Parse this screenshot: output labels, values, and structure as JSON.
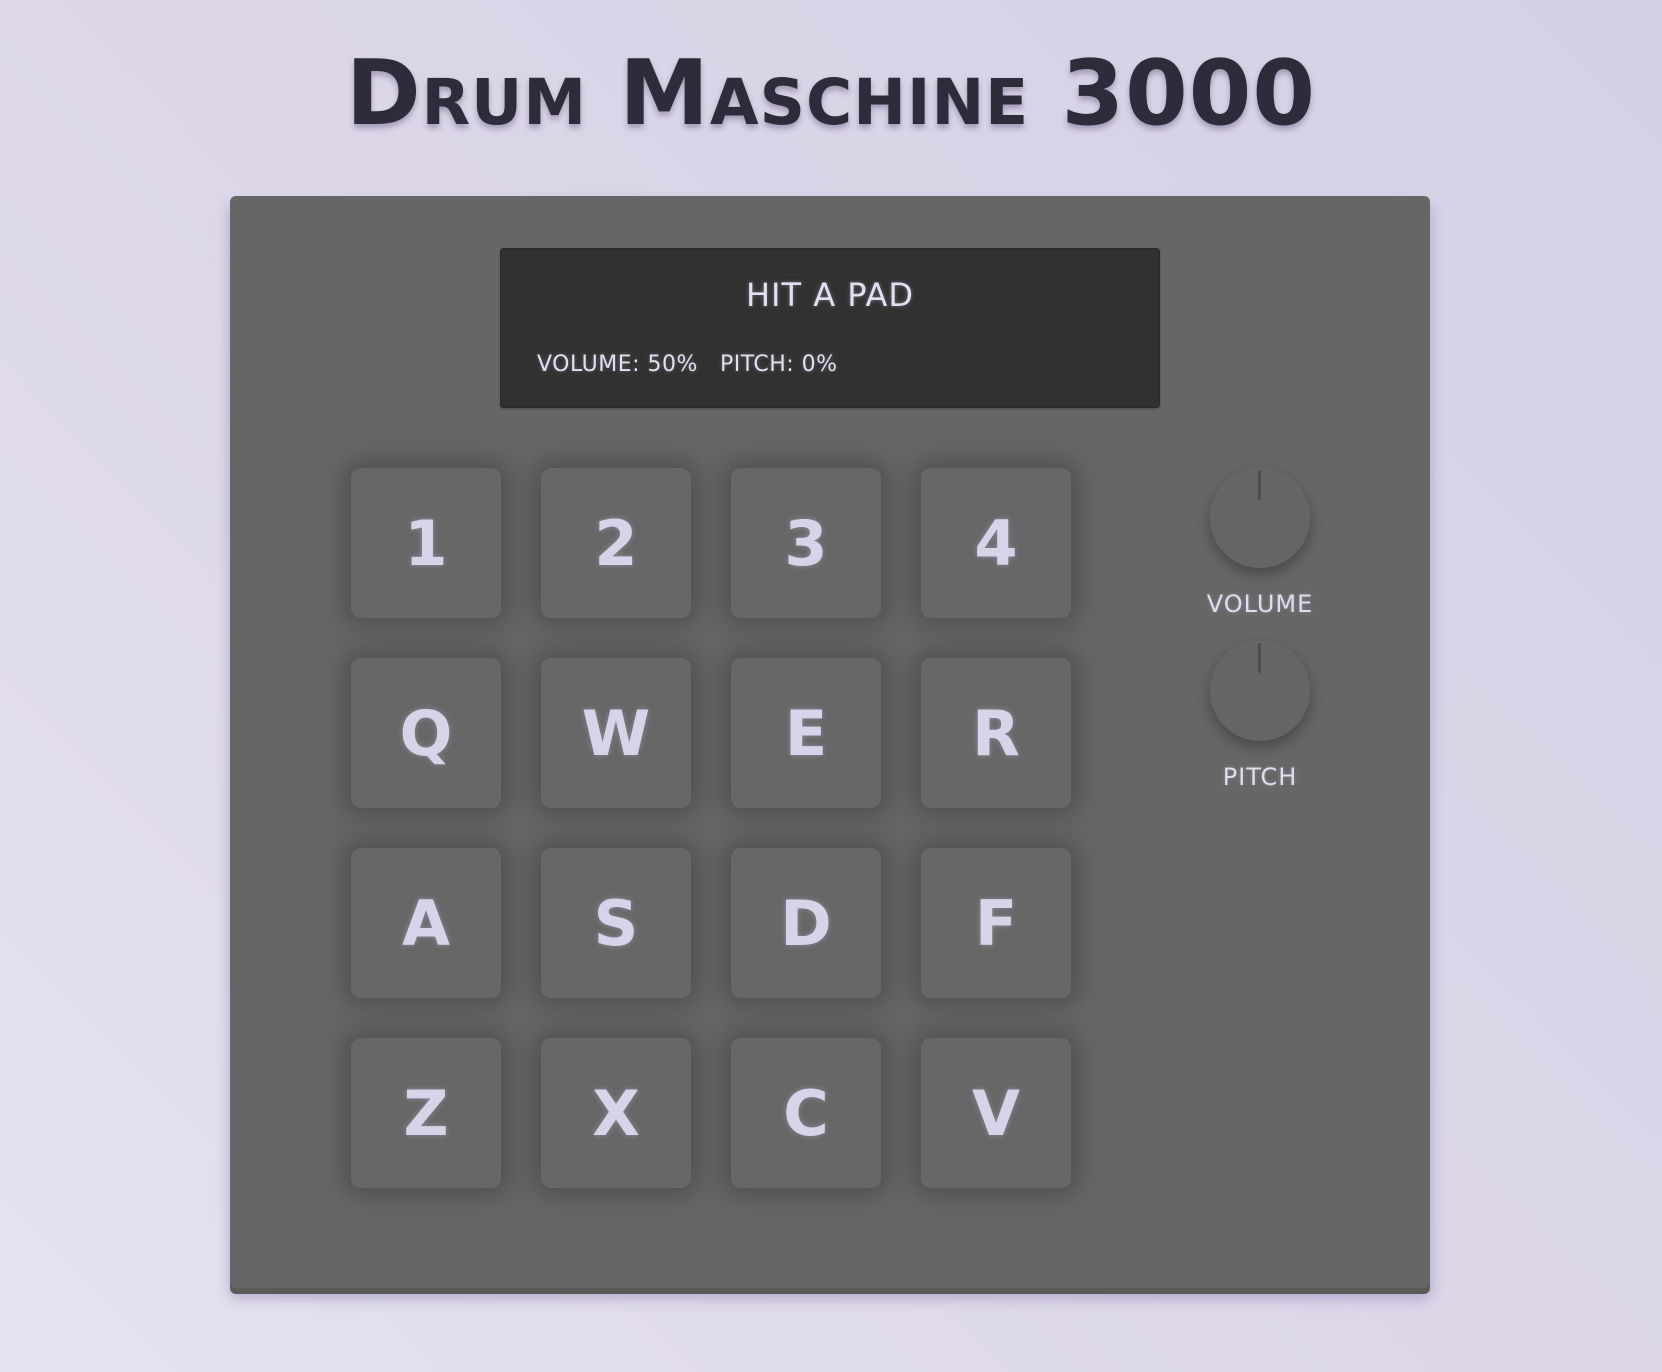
{
  "app": {
    "title": "Drum Maschine 3000"
  },
  "display": {
    "message": "HIT A PAD",
    "volume_text": "VOLUME: 50%",
    "pitch_text": "PITCH: 0%"
  },
  "pads": [
    {
      "key": "1"
    },
    {
      "key": "2"
    },
    {
      "key": "3"
    },
    {
      "key": "4"
    },
    {
      "key": "Q"
    },
    {
      "key": "W"
    },
    {
      "key": "E"
    },
    {
      "key": "R"
    },
    {
      "key": "A"
    },
    {
      "key": "S"
    },
    {
      "key": "D"
    },
    {
      "key": "F"
    },
    {
      "key": "Z"
    },
    {
      "key": "X"
    },
    {
      "key": "C"
    },
    {
      "key": "V"
    }
  ],
  "knobs": {
    "volume": {
      "label": "VOLUME",
      "value_percent": 50
    },
    "pitch": {
      "label": "PITCH",
      "value_percent": 0
    }
  },
  "colors": {
    "background": "#ddd8ea",
    "title": "#2e2b3b",
    "machine": "#666666",
    "display": "#313131",
    "pad": "#676767",
    "pad_text": "#d9d3ea",
    "display_text": "#e4dff0"
  }
}
